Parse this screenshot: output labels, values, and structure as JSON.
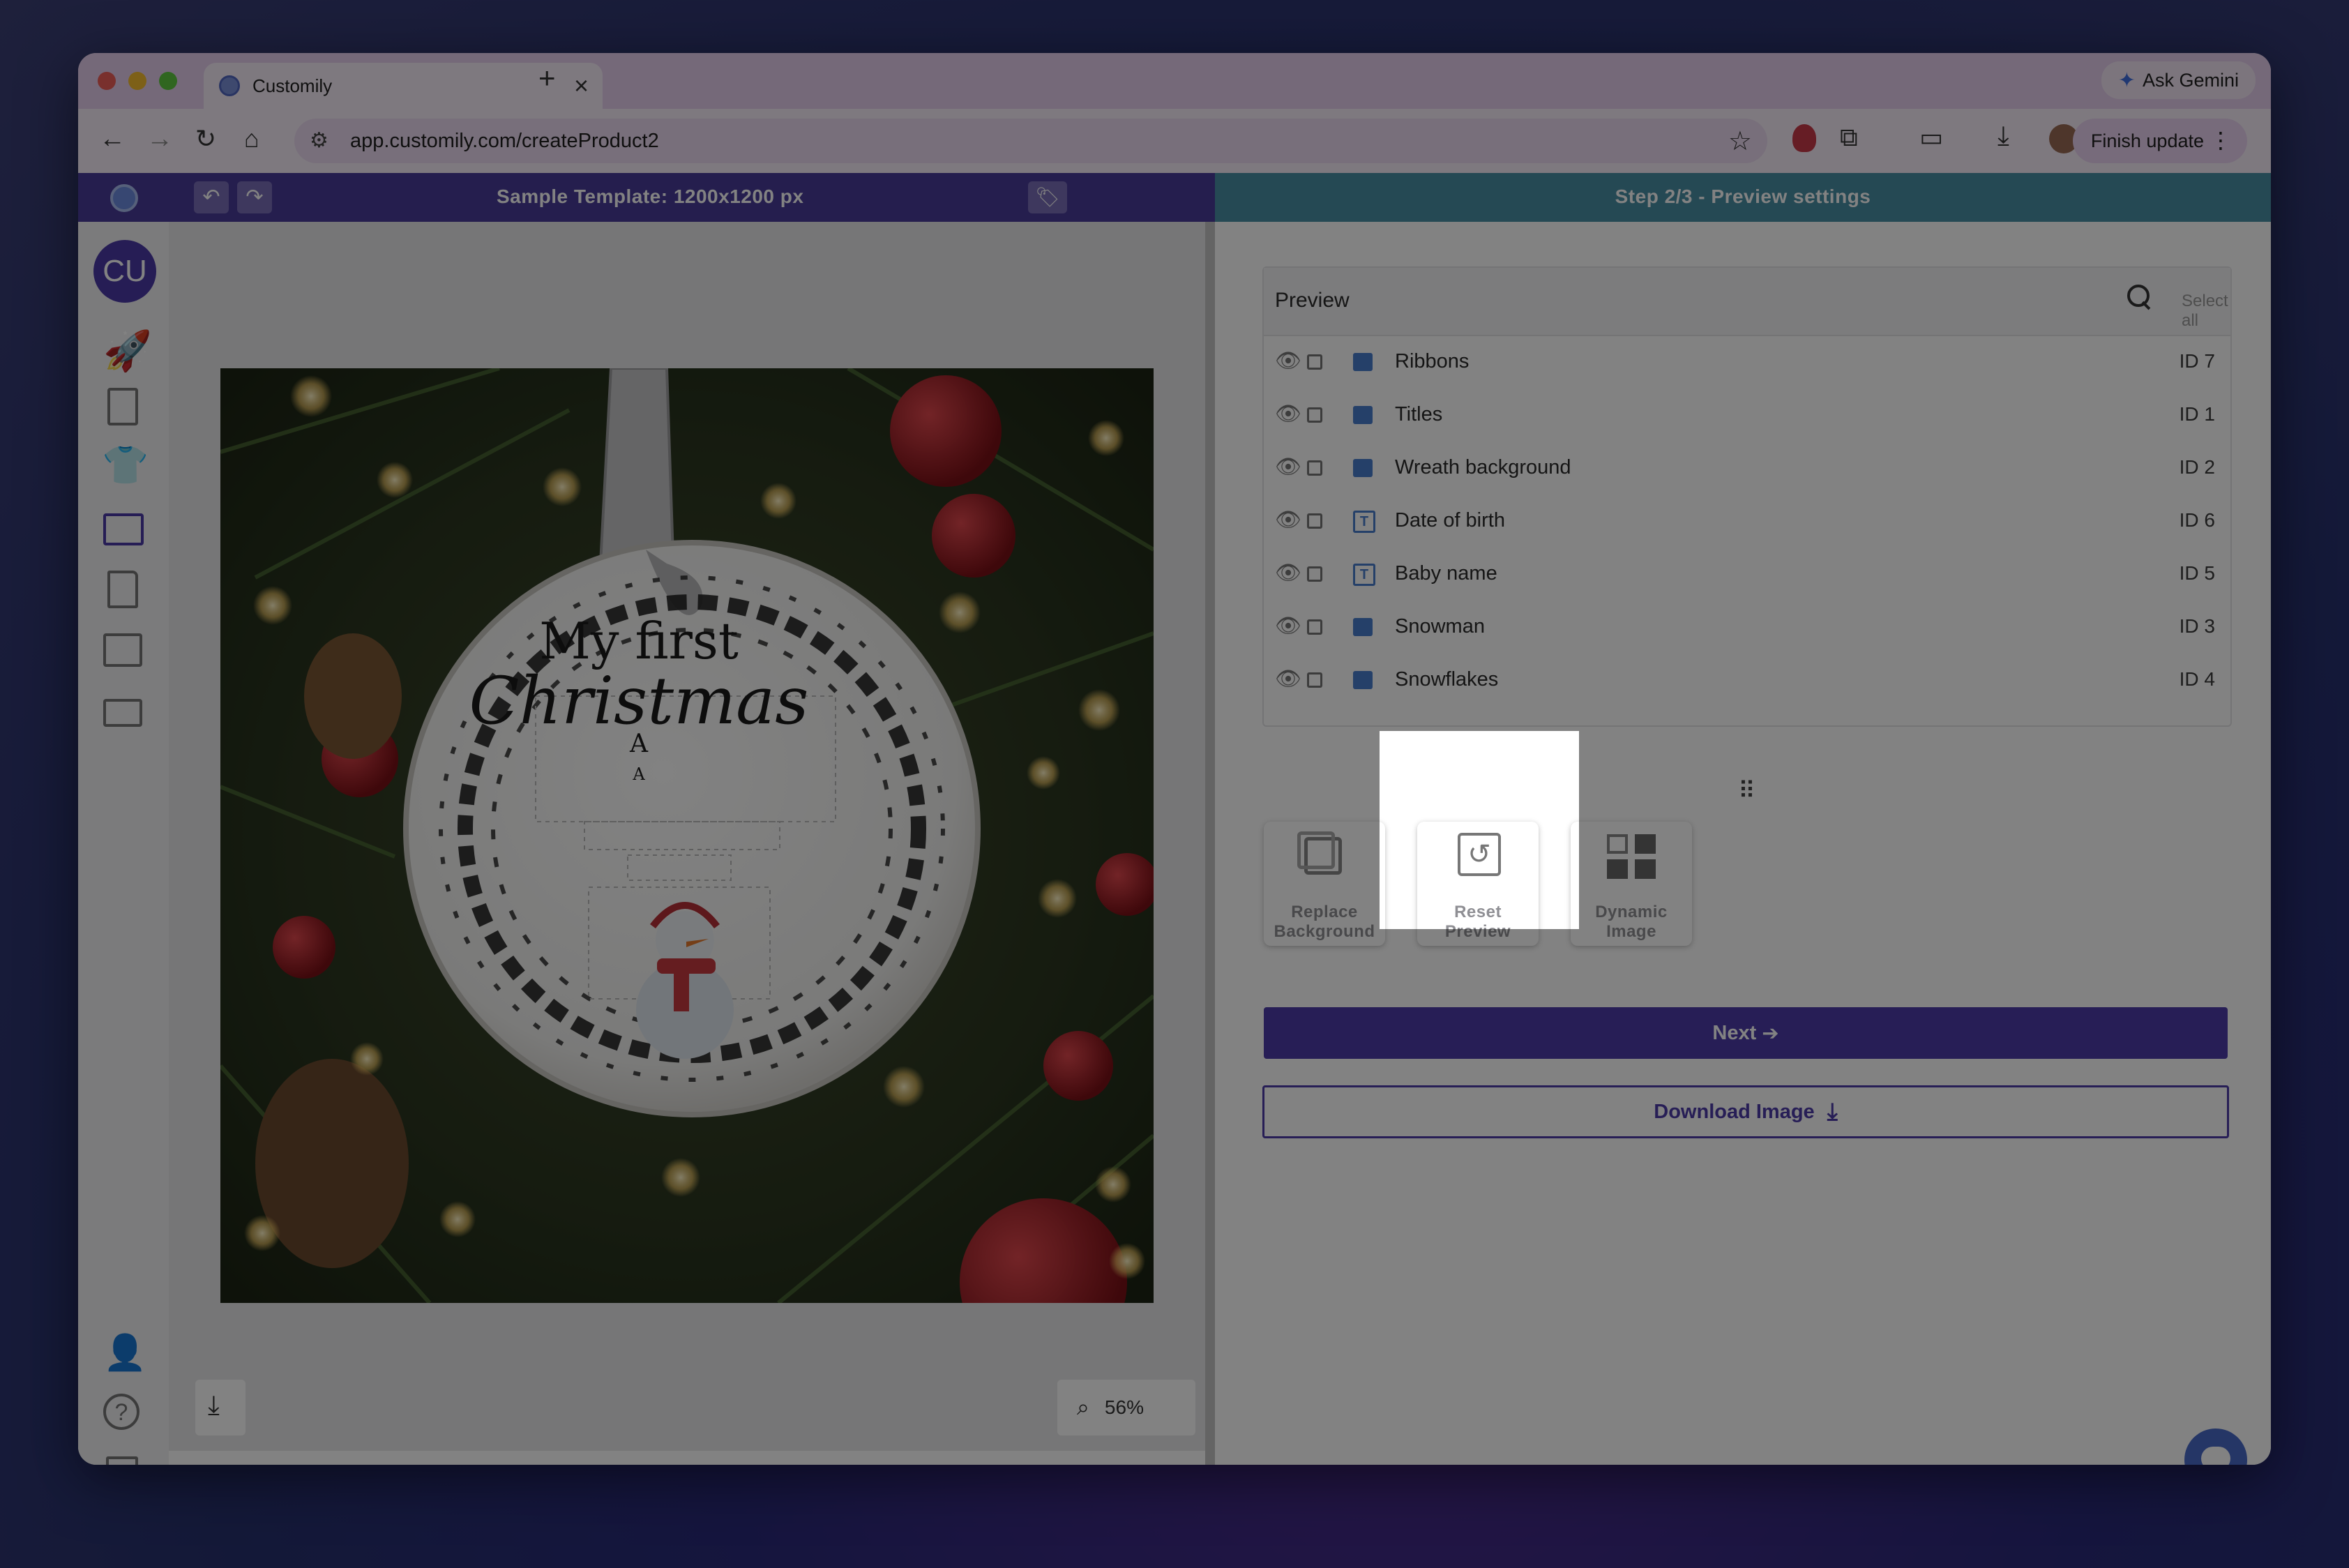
{
  "browser": {
    "tab_title": "Customily",
    "tab_close_icon": "×",
    "new_tab_icon": "+",
    "ask_gemini": "Ask Gemini",
    "url": "app.customily.com/createProduct2",
    "finish_update": "Finish update"
  },
  "app": {
    "template_title": "Sample Template: 1200x1200 px",
    "step_title": "Step 2/3 - Preview settings",
    "avatar_initials": "CU",
    "zoom_level": "56%",
    "ornament_line1": "My first",
    "ornament_line2": "Christmas",
    "ornament_initial_1": "A",
    "ornament_initial_2": "A",
    "brand_color": "#4d3ca9"
  },
  "panel": {
    "title": "Preview",
    "select_all": "Select all",
    "layers": [
      {
        "name": "Ribbons",
        "id": "ID 7",
        "type": "image"
      },
      {
        "name": "Titles",
        "id": "ID 1",
        "type": "image"
      },
      {
        "name": "Wreath background",
        "id": "ID 2",
        "type": "image"
      },
      {
        "name": "Date of birth",
        "id": "ID 6",
        "type": "text"
      },
      {
        "name": "Baby name",
        "id": "ID 5",
        "type": "text"
      },
      {
        "name": "Snowman",
        "id": "ID 3",
        "type": "image"
      },
      {
        "name": "Snowflakes",
        "id": "ID 4",
        "type": "image"
      }
    ]
  },
  "tools": {
    "replace_line1": "Replace",
    "replace_line2": "Background",
    "reset_line1": "Reset",
    "reset_line2": "Preview",
    "dynamic_line1": "Dynamic",
    "dynamic_line2": "Image"
  },
  "actions": {
    "next": "Next",
    "download": "Download Image"
  }
}
